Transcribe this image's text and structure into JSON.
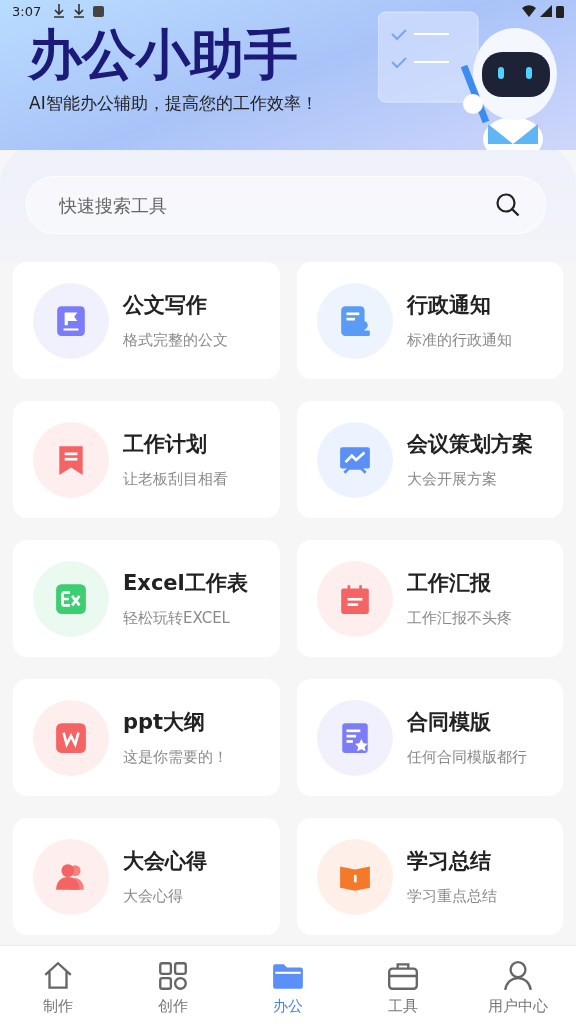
{
  "status_bar": {
    "time": "3:07"
  },
  "header": {
    "title": "办公小助手",
    "subtitle": "AI智能办公辅助，提高您的工作效率！"
  },
  "search": {
    "placeholder": "快速搜索工具"
  },
  "tools": [
    {
      "title": "公文写作",
      "subtitle": "格式完整的公文",
      "kind": "flag-doc",
      "color": "#7b7cf6"
    },
    {
      "title": "行政通知",
      "subtitle": "标准的行政通知",
      "kind": "notice",
      "color": "#5a9cf5"
    },
    {
      "title": "工作计划",
      "subtitle": "让老板刮目相看",
      "kind": "bookmark",
      "color": "#f46464"
    },
    {
      "title": "会议策划方案",
      "subtitle": "大会开展方案",
      "kind": "presentation",
      "color": "#5a8ff5"
    },
    {
      "title": "Excel工作表",
      "subtitle": "轻松玩转EXCEL",
      "kind": "excel",
      "color": "#3dcd72"
    },
    {
      "title": "工作汇报",
      "subtitle": "工作汇报不头疼",
      "kind": "calendar",
      "color": "#f46464"
    },
    {
      "title": "ppt大纲",
      "subtitle": "这是你需要的！",
      "kind": "word",
      "color": "#f46464"
    },
    {
      "title": "合同模版",
      "subtitle": "任何合同模版都行",
      "kind": "contract",
      "color": "#7b7cf6"
    },
    {
      "title": "大会心得",
      "subtitle": "大会心得",
      "kind": "people",
      "color": "#f46464"
    },
    {
      "title": "学习总结",
      "subtitle": "学习重点总结",
      "kind": "book",
      "color": "#f47a2a"
    }
  ],
  "nav": [
    {
      "label": "制作",
      "kind": "home",
      "selected": false
    },
    {
      "label": "创作",
      "kind": "grid",
      "selected": false
    },
    {
      "label": "办公",
      "kind": "folder",
      "selected": true
    },
    {
      "label": "工具",
      "kind": "briefcase",
      "selected": false
    },
    {
      "label": "用户中心",
      "kind": "user",
      "selected": false
    }
  ]
}
